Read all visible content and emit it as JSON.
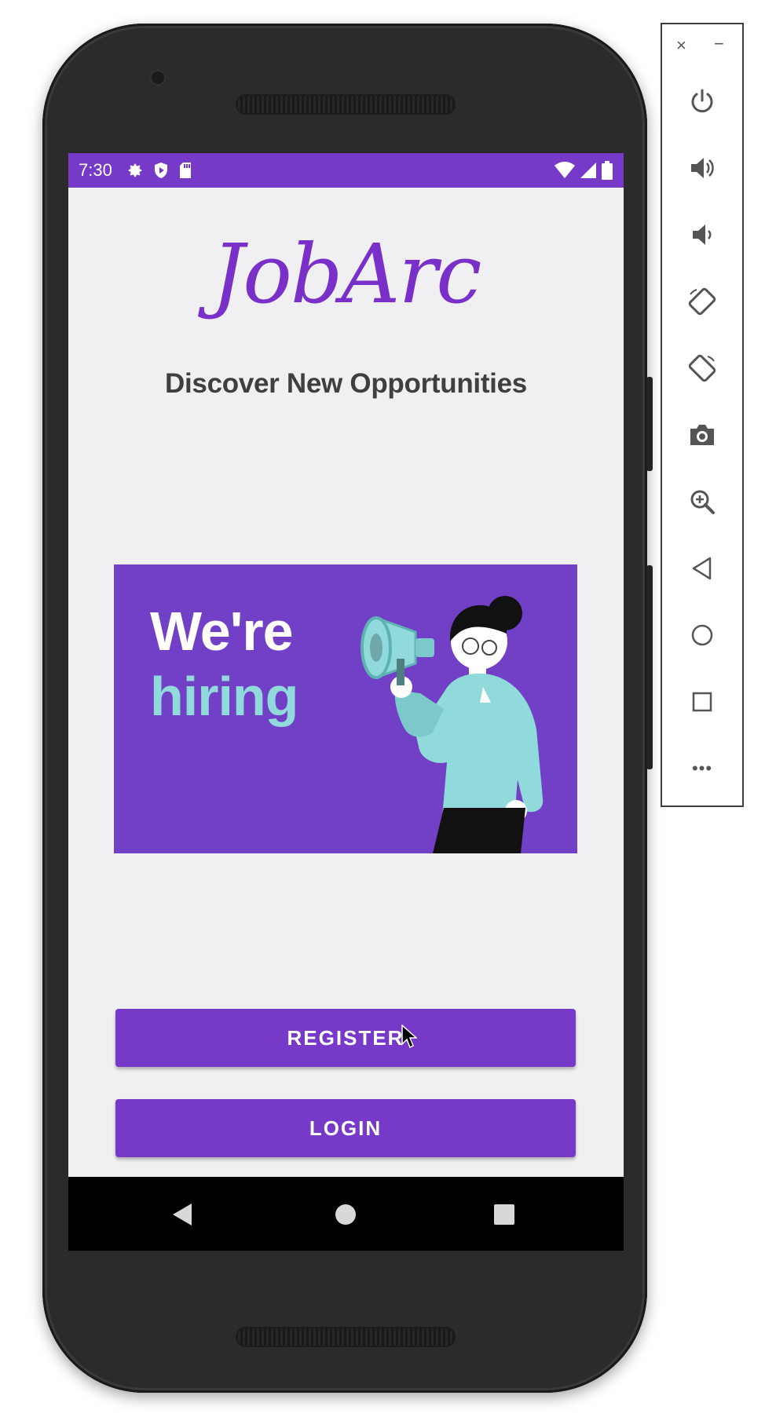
{
  "status_bar": {
    "time": "7:30",
    "left_icons": [
      "gear-icon",
      "shield-icon",
      "sd-card-icon"
    ],
    "right_icons": [
      "wifi-icon",
      "signal-icon",
      "battery-icon"
    ]
  },
  "app": {
    "logo_text": "JobArc",
    "tagline": "Discover New Opportunities",
    "banner": {
      "line1": "We're",
      "line2": "hiring"
    },
    "buttons": {
      "register": "REGISTER",
      "login": "LOGIN"
    }
  },
  "colors": {
    "primary": "#7639c8",
    "banner": "#7240c7",
    "banner_accent": "#90dadc",
    "screen_bg": "#f0eff1"
  },
  "nav_bar": {
    "buttons": [
      "back-icon",
      "home-icon",
      "recents-icon"
    ]
  },
  "emulator_toolbar": {
    "close": "×",
    "minimize": "−",
    "buttons": [
      "power-icon",
      "volume-up-icon",
      "volume-down-icon",
      "rotate-left-icon",
      "rotate-right-icon",
      "camera-icon",
      "zoom-icon",
      "back-icon",
      "home-icon",
      "overview-icon",
      "more-icon"
    ],
    "more": "•••"
  }
}
